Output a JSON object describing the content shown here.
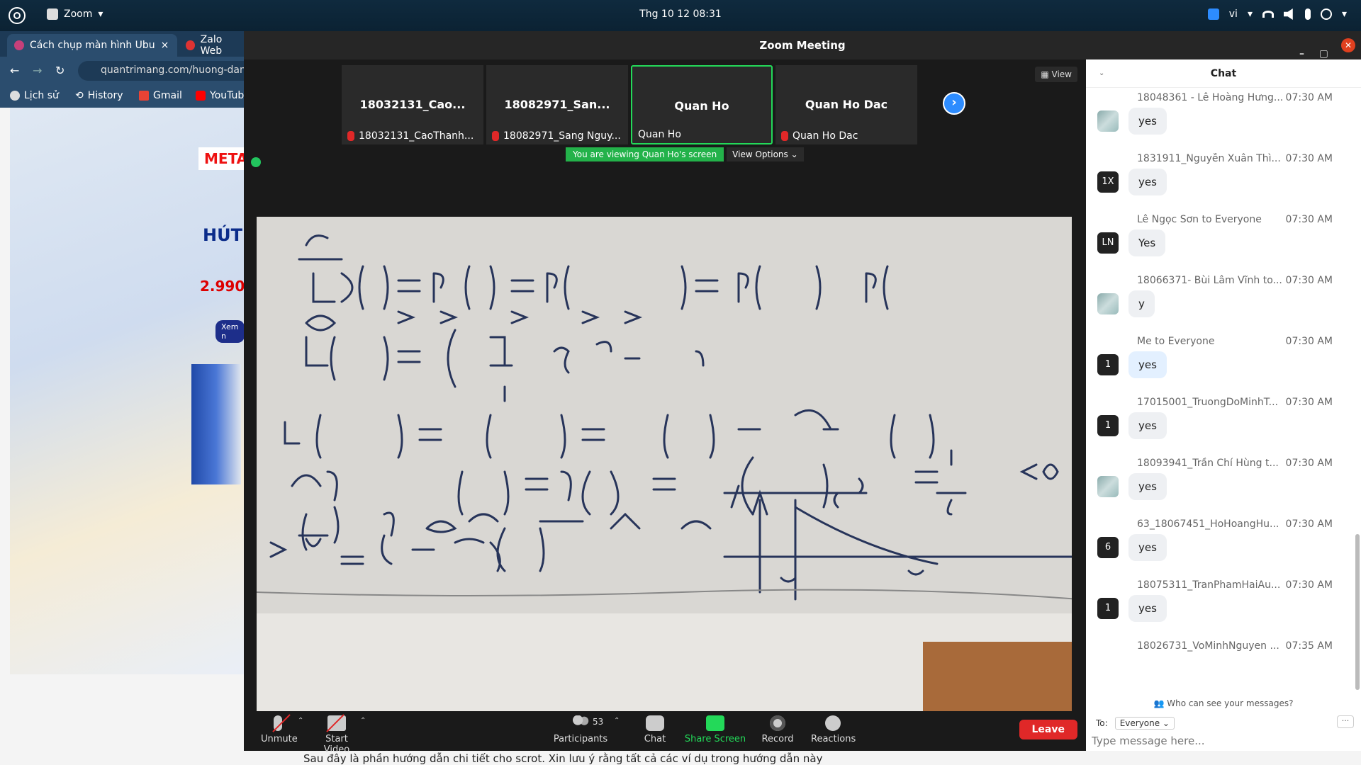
{
  "system": {
    "app_name": "Zoom",
    "clock": "Thg 10 12  08:31",
    "lang": "vi"
  },
  "browser": {
    "tabs": [
      {
        "label": "Cách chụp màn hình Ubu",
        "close": "×"
      },
      {
        "label": "Zalo Web"
      }
    ],
    "url": "quantrimang.com/huong-dan-ch",
    "bookmarks": [
      "Lịch sử",
      "History",
      "Gmail",
      "YouTube"
    ],
    "ad": {
      "logo": "META",
      "headline": "HÚT",
      "price": "2.990",
      "cta": "Xem n"
    },
    "body_text": "Sau đây là phần hướng dẫn chi tiết cho scrot. Xin lưu ý rằng tất cả các ví dụ trong hướng dẫn này"
  },
  "zoom": {
    "title": "Zoom Meeting",
    "view_label": "View",
    "participants": [
      {
        "big": "18032131_Cao...",
        "small": "18032131_CaoThanh...",
        "muted": true,
        "speaking": false
      },
      {
        "big": "18082971_San...",
        "small": "18082971_Sang Nguy...",
        "muted": true,
        "speaking": false
      },
      {
        "big": "Quan Ho",
        "small": "Quan Ho",
        "muted": false,
        "speaking": true
      },
      {
        "big": "Quan Ho Dac",
        "small": "Quan Ho Dac",
        "muted": true,
        "speaking": false
      }
    ],
    "viewing_msg": "You are viewing Quan Ho's screen",
    "view_options": "View Options ⌄",
    "toolbar": {
      "unmute": "Unmute",
      "start_video": "Start Video",
      "participants": "Participants",
      "participants_count": "53",
      "chat": "Chat",
      "share_screen": "Share Screen",
      "record": "Record",
      "reactions": "Reactions",
      "leave": "Leave"
    }
  },
  "chat": {
    "title": "Chat",
    "messages": [
      {
        "sender": "18048361 - Lê Hoàng Hưng...",
        "time": "07:30 AM",
        "text": "yes",
        "avatar": "",
        "photo": true,
        "me": false
      },
      {
        "sender": "1831911_Nguyễn Xuân Thì...",
        "time": "07:30 AM",
        "text": "yes",
        "avatar": "1X",
        "photo": false,
        "me": false
      },
      {
        "sender": "Lê Ngọc Sơn to Everyone",
        "time": "07:30 AM",
        "text": "Yes",
        "avatar": "LN",
        "photo": false,
        "me": false
      },
      {
        "sender": "18066371- Bùi Lâm Vĩnh to...",
        "time": "07:30 AM",
        "text": "y",
        "avatar": "",
        "photo": true,
        "me": false
      },
      {
        "sender": "Me to Everyone",
        "time": "07:30 AM",
        "text": "yes",
        "avatar": "1",
        "photo": false,
        "me": true
      },
      {
        "sender": "17015001_TruongDoMinhT...",
        "time": "07:30 AM",
        "text": "yes",
        "avatar": "1",
        "photo": false,
        "me": false
      },
      {
        "sender": "18093941_Trần Chí Hùng t...",
        "time": "07:30 AM",
        "text": "yes",
        "avatar": "",
        "photo": true,
        "me": false
      },
      {
        "sender": "63_18067451_HoHoangHu...",
        "time": "07:30 AM",
        "text": "yes",
        "avatar": "6",
        "photo": false,
        "me": false
      },
      {
        "sender": "18075311_TranPhamHaiAu...",
        "time": "07:30 AM",
        "text": "yes",
        "avatar": "1",
        "photo": false,
        "me": false
      },
      {
        "sender": "18026731_VoMinhNguyen ...",
        "time": "07:35 AM",
        "text": "",
        "avatar": "",
        "photo": false,
        "me": false
      }
    ],
    "privacy": "Who can see your messages?",
    "to_label": "To:",
    "to_value": "Everyone ⌄",
    "more": "···",
    "placeholder": "Type message here..."
  }
}
